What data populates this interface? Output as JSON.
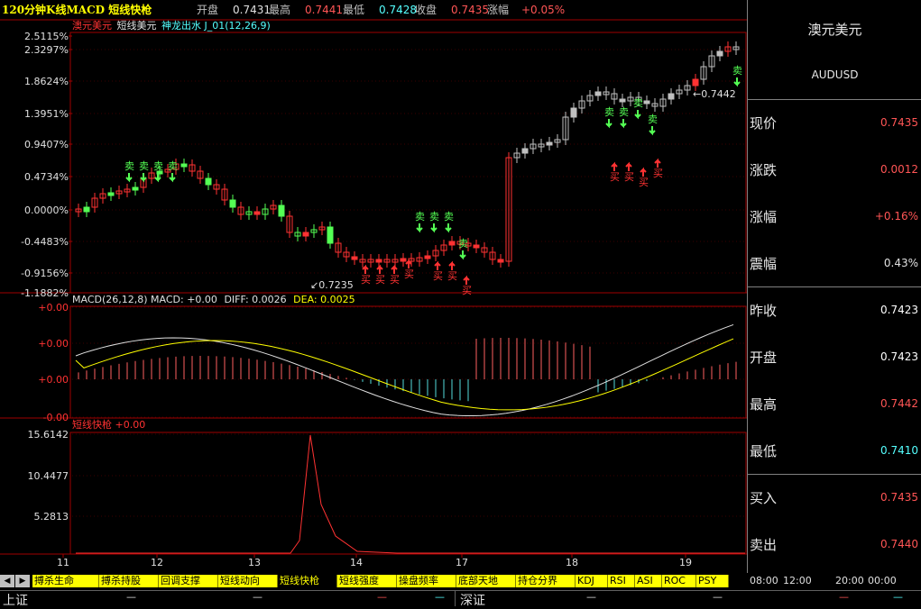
{
  "header": {
    "title": "120分钟K线MACD 短线快枪",
    "open_label": "开盘",
    "open_value": "0.7431",
    "high_label": "最高",
    "high_value": "0.7441",
    "low_label": "最低",
    "low_value": "0.7428",
    "close_label": "收盘",
    "close_value": "0.7435",
    "change_label": "涨幅",
    "change_value": "+0.05%"
  },
  "main_panel": {
    "legend": [
      "澳元美元",
      "短线美元",
      "神龙出水 J_01(12,26,9)"
    ],
    "y_labels": [
      "2.5115%",
      "2.3297%",
      "1.8624%",
      "1.3951%",
      "0.9407%",
      "0.4734%",
      "0.0000%",
      "-0.4483%",
      "-0.9156%",
      "-1.1882%"
    ],
    "annotation_high": "0.7442",
    "annotation_low": "0.7235",
    "buy_signal": "买",
    "sell_signal": "卖"
  },
  "macd_panel": {
    "title": "MACD(26,12,8) MACD: +0.00",
    "diff": "DIFF: 0.0026",
    "dea": "DEA: 0.0025",
    "y_labels": [
      "+0.00",
      "+0.00",
      "+0.00",
      "-0.00"
    ]
  },
  "gun_panel": {
    "title": "短线快枪 +0.00",
    "y_labels": [
      "15.6142",
      "10.4477",
      "5.2813"
    ]
  },
  "x_axis": [
    "11",
    "12",
    "13",
    "14",
    "17",
    "18",
    "19"
  ],
  "side": {
    "name": "澳元美元",
    "code": "AUDUSD",
    "rows": [
      {
        "label": "现价",
        "value": "0.7435",
        "color": "#ff5555"
      },
      {
        "label": "涨跌",
        "value": "0.0012",
        "color": "#ff5555"
      },
      {
        "label": "涨幅",
        "value": "+0.16%",
        "color": "#ff5555"
      },
      {
        "label": "震幅",
        "value": "0.43%",
        "color": "#e0e0e0"
      },
      {
        "label": "昨收",
        "value": "0.7423",
        "color": "#ffffff"
      },
      {
        "label": "开盘",
        "value": "0.7423",
        "color": "#ffffff"
      },
      {
        "label": "最高",
        "value": "0.7442",
        "color": "#ff5555"
      },
      {
        "label": "最低",
        "value": "0.7410",
        "color": "#55ffff"
      },
      {
        "label": "买入",
        "value": "0.7435",
        "color": "#ff5555"
      },
      {
        "label": "卖出",
        "value": "0.7440",
        "color": "#ff5555"
      }
    ]
  },
  "tabs": [
    "搏杀生命",
    "搏杀持股",
    "回调支撑",
    "短线动向",
    "短线快枪",
    "短线强度",
    "操盘频率",
    "底部天地",
    "持仓分界",
    "KDJ",
    "RSI",
    "ASI",
    "ROC",
    "PSY"
  ],
  "active_tab": "短线快枪",
  "time_left": "08:00",
  "time_mid": "12:00",
  "time_right": "20:00",
  "time_right2": "00:00",
  "status": {
    "sh": "上证",
    "sz": "深证",
    "dash": "—"
  },
  "colors": {
    "up": "#ff3232",
    "down": "#54ff54",
    "neutral": "#c0c0c0",
    "yellow": "#ffff00",
    "cyan": "#55ffff"
  }
}
